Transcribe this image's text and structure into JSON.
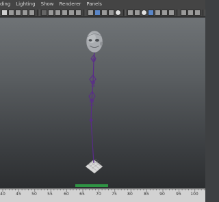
{
  "menubar": {
    "items": [
      {
        "label": "ding"
      },
      {
        "label": "Lighting"
      },
      {
        "label": "Show"
      },
      {
        "label": "Renderer"
      },
      {
        "label": "Panels"
      }
    ]
  },
  "viewport": {
    "camera_label": "",
    "colors": {
      "bg_top": "#6f7376",
      "bg_bottom": "#2c2e30",
      "skeleton": "#5a2a8c",
      "head": "#a9acb0",
      "grid": "#2fae4a"
    }
  },
  "timeslider": {
    "frames": [
      "40",
      "45",
      "50",
      "55",
      "60",
      "65",
      "70",
      "75",
      "80",
      "85",
      "90",
      "95",
      "100"
    ]
  }
}
